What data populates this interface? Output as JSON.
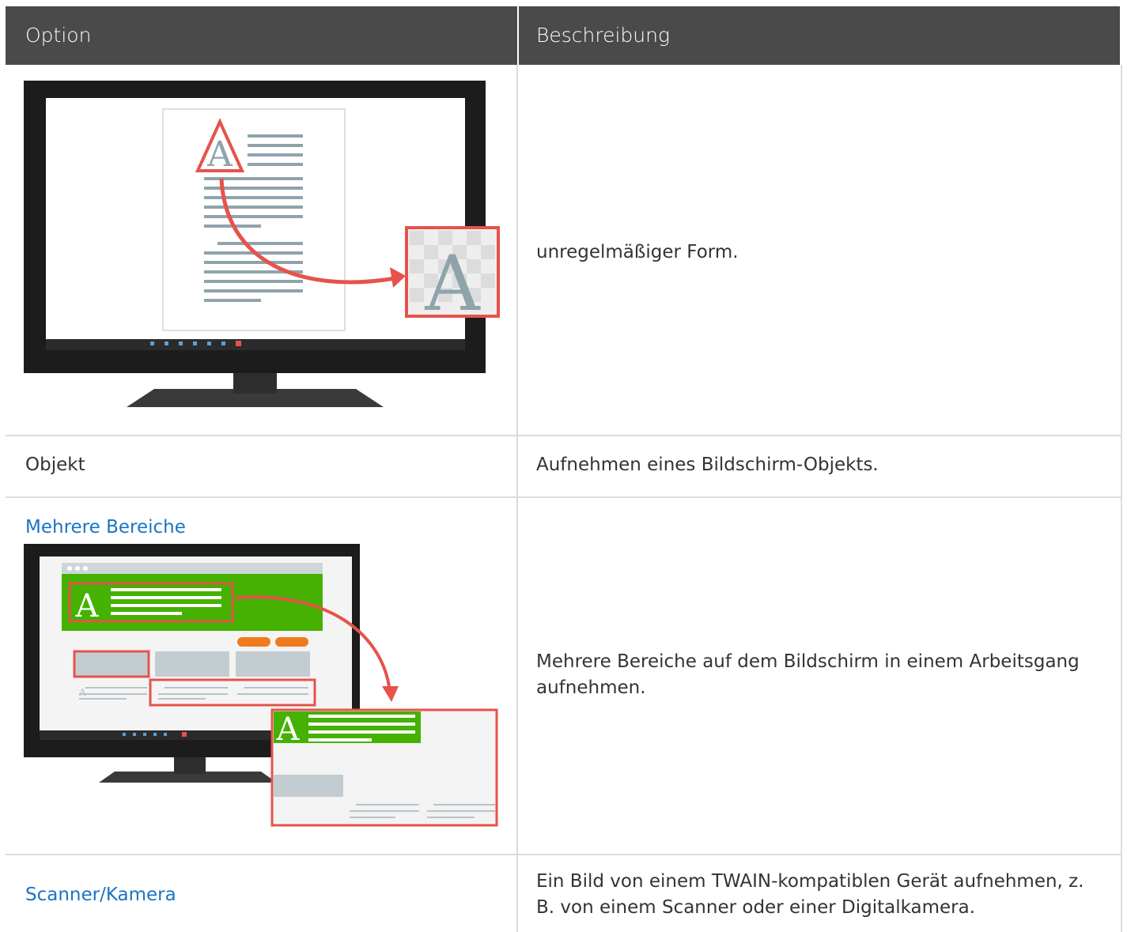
{
  "header": {
    "col_option": "Option",
    "col_description": "Beschreibung"
  },
  "rows": [
    {
      "option": "",
      "description": "unregelmäßiger Form."
    },
    {
      "option": "Objekt",
      "description": "Aufnehmen eines Bildschirm-Objekts."
    },
    {
      "option": "Mehrere Bereiche",
      "description": "Mehrere Bereiche auf dem Bildschirm in einem Arbeitsgang aufnehmen."
    },
    {
      "option": "Scanner/Kamera",
      "description": "Ein Bild von einem TWAIN-kompatiblen Gerät aufnehmen, z. B. von einem Scanner oder einer Digitalkamera."
    }
  ],
  "illustrations": {
    "letter": "A",
    "colors": {
      "accent_red": "#e5534b",
      "green": "#45b100",
      "orange": "#f07b1e",
      "gray_line": "#8fa3ab",
      "link_blue": "#1a74c4"
    }
  }
}
